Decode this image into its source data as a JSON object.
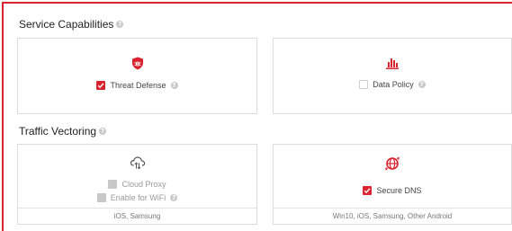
{
  "sections": {
    "service": {
      "title": "Service Capabilities",
      "cards": [
        {
          "icon": "shield-bug-icon",
          "options": [
            {
              "label": "Threat Defense",
              "checked": true,
              "help": true
            }
          ]
        },
        {
          "icon": "bar-chart-icon",
          "options": [
            {
              "label": "Data Policy",
              "checked": false,
              "help": true
            }
          ]
        }
      ]
    },
    "traffic": {
      "title": "Traffic Vectoring",
      "cards": [
        {
          "icon": "cloud-sync-icon",
          "options": [
            {
              "label": "Cloud Proxy",
              "checked": false,
              "disabled": true
            },
            {
              "label": "Enable for WiFi",
              "checked": false,
              "disabled": true,
              "help": true
            }
          ],
          "footer": "iOS, Samsung"
        },
        {
          "icon": "globe-sync-icon",
          "options": [
            {
              "label": "Secure DNS",
              "checked": true
            }
          ],
          "footer": "Win10, iOS, Samsung, Other Android"
        }
      ]
    }
  },
  "help_glyph": "?",
  "check_glyph": "✓",
  "colors": {
    "accent": "#d9232e",
    "border": "#dcdcdc",
    "disabled": "#c8c8c8"
  }
}
